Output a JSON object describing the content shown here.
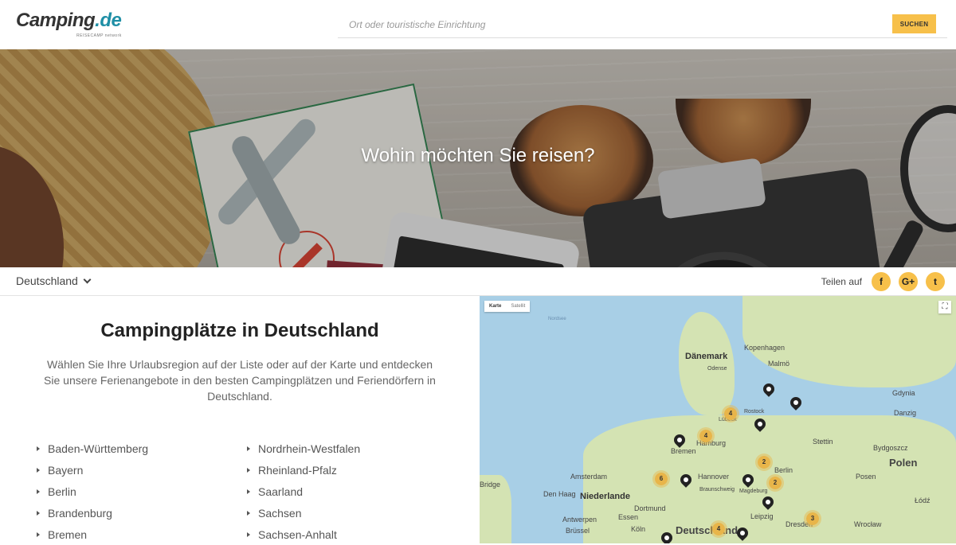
{
  "header": {
    "logo_text": "Camping",
    "logo_tld": ".de",
    "logo_sub": "REISECAMP network",
    "search_placeholder": "Ort oder touristische Einrichtung",
    "search_button": "SUCHEN"
  },
  "hero": {
    "title": "Wohin möchten Sie reisen?"
  },
  "country_bar": {
    "selected_country": "Deutschland",
    "share_label": "Teilen auf",
    "social": [
      {
        "name": "facebook",
        "glyph": "f"
      },
      {
        "name": "google-plus",
        "glyph": "G+"
      },
      {
        "name": "twitter",
        "glyph": "t"
      }
    ]
  },
  "content": {
    "title": "Campingplätze in Deutschland",
    "intro": "Wählen Sie Ihre Urlaubsregion auf der Liste oder auf der Karte und entdecken Sie unsere Ferienangebote in den besten Campingplätzen und Feriendörfern in Deutschland.",
    "regions_col1": [
      "Baden-Württemberg",
      "Bayern",
      "Berlin",
      "Brandenburg",
      "Bremen"
    ],
    "regions_col2": [
      "Nordrhein-Westfalen",
      "Rheinland-Pfalz",
      "Saarland",
      "Sachsen",
      "Sachsen-Anhalt"
    ]
  },
  "map": {
    "toggle_map": "Karte",
    "toggle_satellite": "Satellit",
    "places": {
      "nordsee": "Nordsee",
      "danemark": "Dänemark",
      "kopenhagen": "Kopenhagen",
      "odense": "Odense",
      "malmo": "Malmö",
      "gdynia": "Gdynia",
      "danzig": "Danzig",
      "rostock": "Rostock",
      "lubeck": "Lübeck",
      "hamburg": "Hamburg",
      "stettin": "Stettin",
      "bremen": "Bremen",
      "bydgoszcz": "Bydgoszcz",
      "polen": "Polen",
      "amsterdam": "Amsterdam",
      "hannover": "Hannover",
      "berlin": "Berlin",
      "posen": "Posen",
      "den_haag": "Den Haag",
      "niederlande": "Niederlande",
      "braunschweig": "Braunschweig",
      "magdeburg": "Magdeburg",
      "lodz": "Łódź",
      "dortmund": "Dortmund",
      "antwerpen": "Antwerpen",
      "essen": "Essen",
      "leipzig": "Leipzig",
      "brussel": "Brüssel",
      "koln": "Köln",
      "deutschland": "Deutschland",
      "dresden": "Dresden",
      "wroclaw": "Wrocław",
      "bridge": "Bridge"
    },
    "clusters": [
      "4",
      "4",
      "2",
      "6",
      "2",
      "4",
      "3"
    ]
  }
}
